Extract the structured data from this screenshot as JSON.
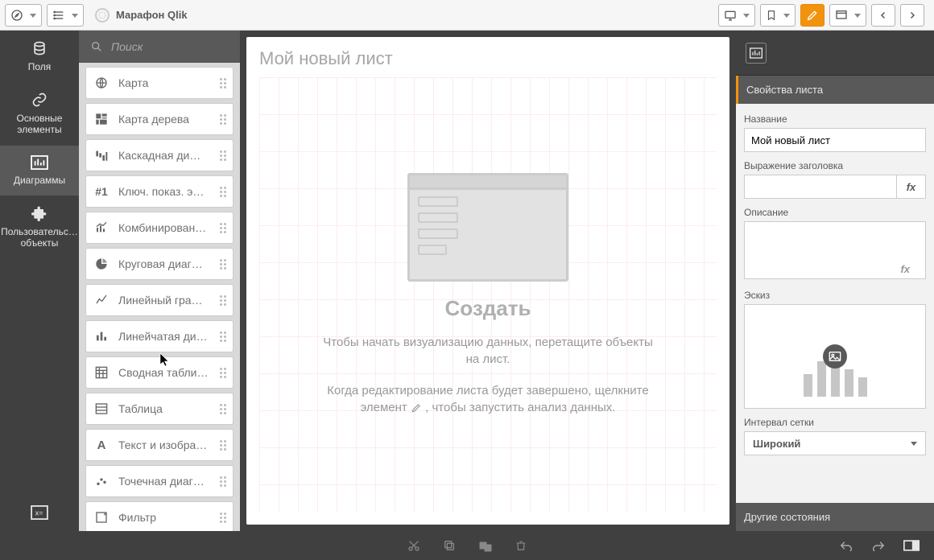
{
  "app": {
    "title": "Марафон Qlik"
  },
  "rail": {
    "fields": "Поля",
    "master": "Основные элементы",
    "charts": "Диаграммы",
    "custom": "Пользовательс… объекты"
  },
  "search": {
    "placeholder": "Поиск"
  },
  "assets": [
    {
      "label": "Карта",
      "icon": "globe"
    },
    {
      "label": "Карта дерева",
      "icon": "treemap"
    },
    {
      "label": "Каскадная ди…",
      "icon": "waterfall"
    },
    {
      "label": "Ключ. показ. э…",
      "icon": "kpi"
    },
    {
      "label": "Комбинирован…",
      "icon": "combo"
    },
    {
      "label": "Круговая диаг…",
      "icon": "pie"
    },
    {
      "label": "Линейный гра…",
      "icon": "line"
    },
    {
      "label": "Линейчатая ди…",
      "icon": "bar"
    },
    {
      "label": "Сводная табли…",
      "icon": "pivot"
    },
    {
      "label": "Таблица",
      "icon": "table"
    },
    {
      "label": "Текст и изобра…",
      "icon": "text"
    },
    {
      "label": "Точечная диаг…",
      "icon": "scatter"
    },
    {
      "label": "Фильтр",
      "icon": "filter"
    }
  ],
  "sheet": {
    "title": "Мой новый лист",
    "create": "Создать",
    "hint1": "Чтобы начать визуализацию данных, перетащите объекты на лист.",
    "hint2a": "Когда редактирование листа будет завершено, щелкните элемент ",
    "hint2b": ", чтобы запустить анализ данных."
  },
  "props": {
    "header": "Свойства листа",
    "name_label": "Название",
    "name_value": "Мой новый лист",
    "title_expr_label": "Выражение заголовка",
    "title_expr_value": "",
    "desc_label": "Описание",
    "thumb_label": "Эскиз",
    "grid_label": "Интервал сетки",
    "grid_value": "Широкий",
    "other_states": "Другие состояния"
  }
}
